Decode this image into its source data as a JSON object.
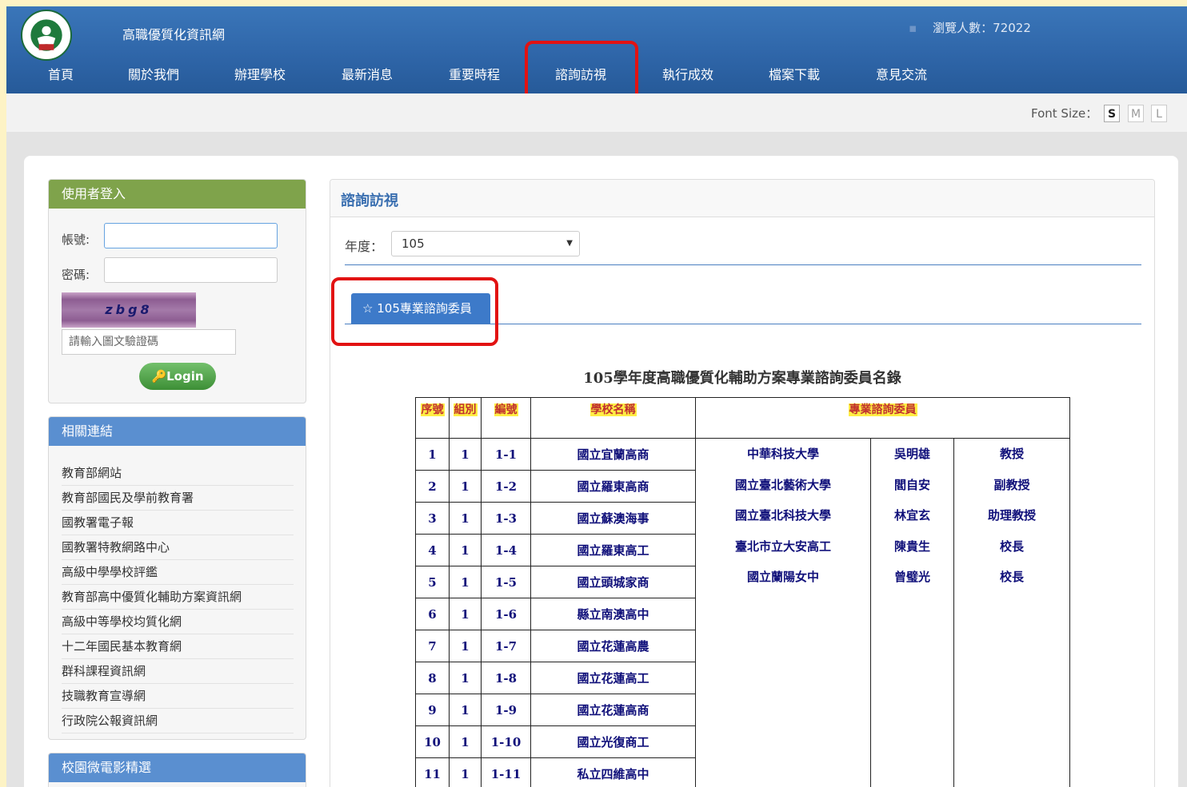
{
  "header": {
    "site_title": "高職優質化資訊網",
    "visitor_count": "瀏覽人數：72022"
  },
  "nav": [
    {
      "label": "首頁"
    },
    {
      "label": "關於我們"
    },
    {
      "label": "辦理學校"
    },
    {
      "label": "最新消息"
    },
    {
      "label": "重要時程"
    },
    {
      "label": "諮詢訪視"
    },
    {
      "label": "執行成效"
    },
    {
      "label": "檔案下載"
    },
    {
      "label": "意見交流"
    }
  ],
  "font_size": {
    "label": "Font Size：",
    "options": [
      "S",
      "M",
      "L"
    ],
    "selected": "S"
  },
  "login": {
    "title": "使用者登入",
    "account_label": "帳號:",
    "password_label": "密碼:",
    "captcha_text": "zbg8",
    "captcha_placeholder": "請輸入圖文驗證碼",
    "login_button": "Login"
  },
  "links": {
    "title": "相關連結",
    "items": [
      "教育部網站",
      "教育部國民及學前教育署",
      "國教署電子報",
      "國教署特教網路中心",
      "高級中學學校評鑑",
      "教育部高中優質化輔助方案資訊網",
      "高級中等學校均質化網",
      "十二年國民基本教育網",
      "群科課程資訊網",
      "技職教育宣導網",
      "行政院公報資訊網"
    ]
  },
  "video": {
    "title": "校園微電影精選"
  },
  "content": {
    "title": "諮詢訪視",
    "year_label": "年度：",
    "year_value": "105",
    "tab_label": "105專業諮詢委員",
    "table_title": "105學年度高職優質化輔助方案專業諮詢委員名錄",
    "headers": {
      "seq": "序號",
      "group": "組別",
      "code": "編號",
      "school": "學校名稱",
      "consultant": "專業諮詢委員"
    },
    "rows": [
      {
        "seq": "1",
        "group": "1",
        "code": "1-1",
        "school": "國立宜蘭高商"
      },
      {
        "seq": "2",
        "group": "1",
        "code": "1-2",
        "school": "國立羅東高商"
      },
      {
        "seq": "3",
        "group": "1",
        "code": "1-3",
        "school": "國立蘇澳海事"
      },
      {
        "seq": "4",
        "group": "1",
        "code": "1-4",
        "school": "國立羅東高工"
      },
      {
        "seq": "5",
        "group": "1",
        "code": "1-5",
        "school": "國立頭城家商"
      },
      {
        "seq": "6",
        "group": "1",
        "code": "1-6",
        "school": "縣立南澳高中"
      },
      {
        "seq": "7",
        "group": "1",
        "code": "1-7",
        "school": "國立花蓮高農"
      },
      {
        "seq": "8",
        "group": "1",
        "code": "1-8",
        "school": "國立花蓮高工"
      },
      {
        "seq": "9",
        "group": "1",
        "code": "1-9",
        "school": "國立花蓮高商"
      },
      {
        "seq": "10",
        "group": "1",
        "code": "1-10",
        "school": "國立光復商工"
      },
      {
        "seq": "11",
        "group": "1",
        "code": "1-11",
        "school": "私立四維高中"
      }
    ],
    "consultants": [
      {
        "org": "中華科技大學",
        "name": "吳明雄",
        "title": "教授"
      },
      {
        "org": "國立臺北藝術大學",
        "name": "閻自安",
        "title": "副教授"
      },
      {
        "org": "國立臺北科技大學",
        "name": "林宜玄",
        "title": "助理教授"
      },
      {
        "org": "臺北市立大安高工",
        "name": "陳貴生",
        "title": "校長"
      },
      {
        "org": "國立蘭陽女中",
        "name": "曾璧光",
        "title": "校長"
      }
    ]
  }
}
